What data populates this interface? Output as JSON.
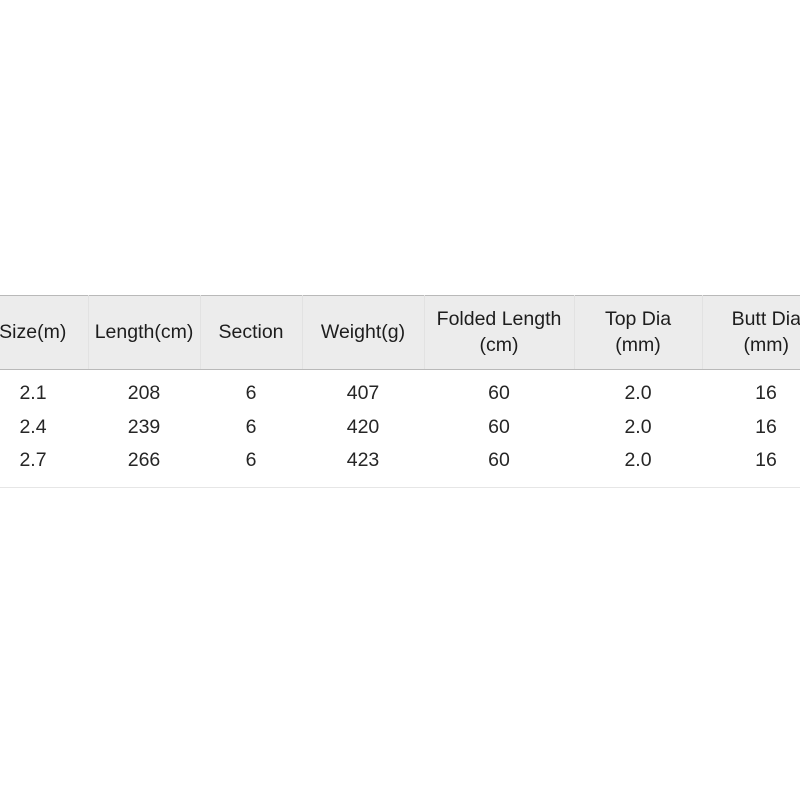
{
  "spec_table": {
    "columns": [
      {
        "line1": "Size(m)",
        "line2": ""
      },
      {
        "line1": "Length(cm)",
        "line2": ""
      },
      {
        "line1": "Section",
        "line2": ""
      },
      {
        "line1": "Weight(g)",
        "line2": ""
      },
      {
        "line1": "Folded Length",
        "line2": "(cm)"
      },
      {
        "line1": "Top Dia",
        "line2": "(mm)"
      },
      {
        "line1": "Butt Dia",
        "line2": "(mm)"
      }
    ],
    "rows": [
      {
        "size": "2.1",
        "length": "208",
        "section": "6",
        "weight": "407",
        "folded_length": "60",
        "top_dia": "2.0",
        "butt_dia": "16"
      },
      {
        "size": "2.4",
        "length": "239",
        "section": "6",
        "weight": "420",
        "folded_length": "60",
        "top_dia": "2.0",
        "butt_dia": "16"
      },
      {
        "size": "2.7",
        "length": "266",
        "section": "6",
        "weight": "423",
        "folded_length": "60",
        "top_dia": "2.0",
        "butt_dia": "16"
      }
    ],
    "colors": {
      "header_background": "#ececec",
      "header_border": "#b9b9b9",
      "header_text": "#1d1d1d",
      "body_background": "#ffffff",
      "body_text": "#262626",
      "bottom_rule": "#e6e6e6",
      "column_divider": "#e2e2e2"
    }
  }
}
